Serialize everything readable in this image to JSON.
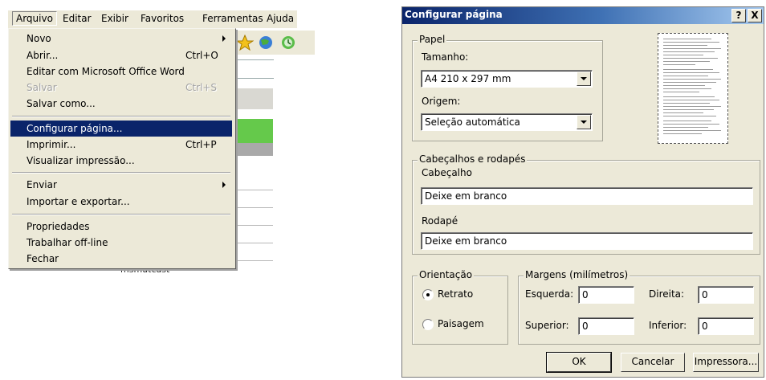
{
  "menubar": {
    "items": [
      {
        "label": "Arquivo",
        "active": true
      },
      {
        "label": "Editar"
      },
      {
        "label": "Exibir"
      },
      {
        "label": "Favoritos"
      },
      {
        "label": "Ferramentas"
      },
      {
        "label": "Ajuda"
      }
    ]
  },
  "file_menu": {
    "items": [
      {
        "label": "Novo",
        "submenu": true
      },
      {
        "label": "Abrir...",
        "shortcut": "Ctrl+O"
      },
      {
        "label": "Editar com Microsoft Office Word"
      },
      {
        "label": "Salvar",
        "shortcut": "Ctrl+S",
        "disabled": true
      },
      {
        "label": "Salvar como..."
      },
      {
        "label": "Configurar página...",
        "selected": true
      },
      {
        "label": "Imprimir...",
        "shortcut": "Ctrl+P"
      },
      {
        "label": "Visualizar impressão..."
      },
      {
        "label": "Enviar",
        "submenu": true
      },
      {
        "label": "Importar e exportar..."
      },
      {
        "label": "Propriedades"
      },
      {
        "label": "Trabalhar off-line"
      },
      {
        "label": "Fechar"
      }
    ]
  },
  "background_page": {
    "cut_text": "msmutcast"
  },
  "dialog": {
    "title": "Configurar página",
    "help_button": "?",
    "close_button": "X",
    "paper": {
      "group_label": "Papel",
      "size_label": "Tamanho:",
      "size_value": "A4 210 x 297 mm",
      "source_label": "Origem:",
      "source_value": "Seleção automática"
    },
    "headers_footers": {
      "group_label": "Cabeçalhos e rodapés",
      "header_label": "Cabeçalho",
      "header_value": "Deixe em branco",
      "footer_label": "Rodapé",
      "footer_value": "Deixe em branco"
    },
    "orientation": {
      "group_label": "Orientação",
      "portrait_label": "Retrato",
      "landscape_label": "Paisagem",
      "selected": "portrait"
    },
    "margins": {
      "group_label": "Margens (milímetros)",
      "left_label": "Esquerda:",
      "left_value": "0",
      "right_label": "Direita:",
      "right_value": "0",
      "top_label": "Superior:",
      "top_value": "0",
      "bottom_label": "Inferior:",
      "bottom_value": "0"
    },
    "buttons": {
      "ok": "OK",
      "cancel": "Cancelar",
      "printer": "Impressora..."
    }
  }
}
